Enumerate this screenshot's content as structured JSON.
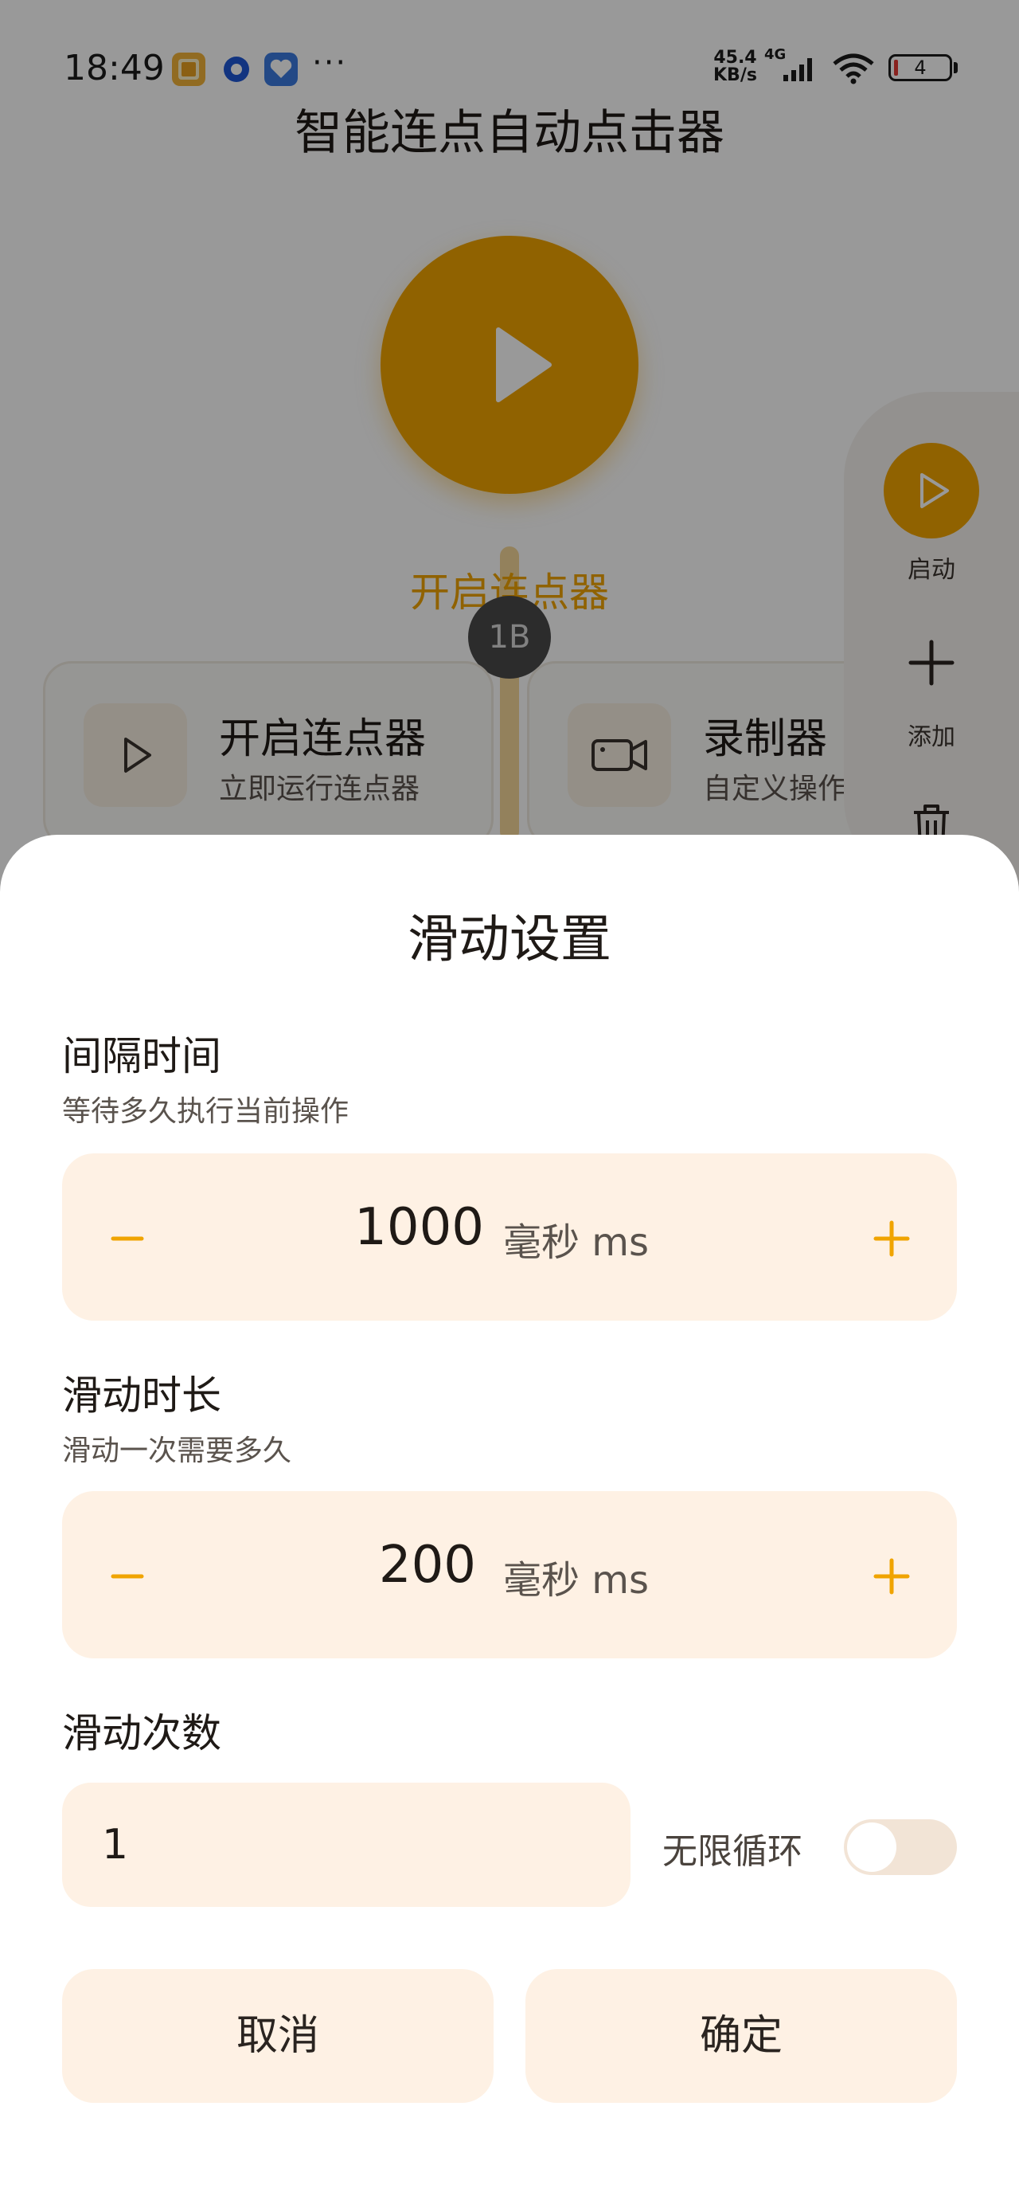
{
  "status_bar": {
    "time": "18:49",
    "speed_value": "45.4",
    "speed_unit": "KB/s",
    "network": "4G",
    "battery": "4",
    "app_icons": [
      "gallery-app-icon",
      "circle-app-icon",
      "heart-shield-app-icon"
    ],
    "more": "···"
  },
  "app": {
    "title": "智能连点自动点击器",
    "start_label": "开启连点器",
    "bubble_badge": "1B",
    "cards": [
      {
        "title": "开启连点器",
        "subtitle": "立即运行连点器",
        "icon": "play-outline-icon"
      },
      {
        "title": "录制器",
        "subtitle": "自定义操作",
        "icon": "video-camera-icon"
      }
    ],
    "floating_panel": {
      "start_label": "启动",
      "add_label": "添加"
    }
  },
  "sheet": {
    "title": "滑动设置",
    "interval": {
      "label": "间隔时间",
      "desc": "等待多久执行当前操作",
      "value": "1000",
      "unit": "毫秒 ms"
    },
    "duration": {
      "label": "滑动时长",
      "desc": "滑动一次需要多久",
      "value": "200",
      "unit": "毫秒 ms"
    },
    "count": {
      "label": "滑动次数",
      "value": "1",
      "loop_label": "无限循环",
      "loop_enabled": false
    },
    "cancel_label": "取消",
    "confirm_label": "确定"
  },
  "colors": {
    "accent": "#f0a400",
    "field_bg": "#fef1e4",
    "text": "#1f1a16"
  }
}
